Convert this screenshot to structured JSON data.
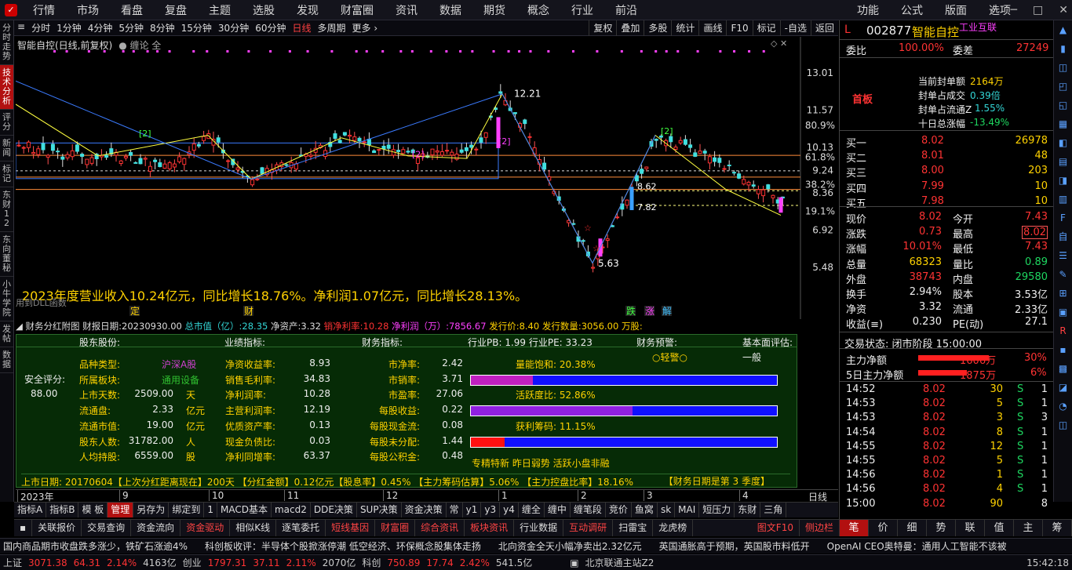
{
  "menu": [
    "行情",
    "市场",
    "看盘",
    "复盘",
    "主题",
    "选股",
    "发现",
    "财富圈",
    "资讯",
    "数据",
    "期货",
    "概念",
    "行业",
    "前沿"
  ],
  "menu_right": [
    "功能",
    "公式",
    "版面",
    "选项"
  ],
  "left_rail": [
    "分时走势",
    "技术分析",
    "评分",
    "新闻",
    "标记",
    "东财12",
    "东向董秘",
    "小牛学院",
    "发帖",
    "数据"
  ],
  "toolbar": {
    "periods": [
      "分时",
      "1分钟",
      "4分钟",
      "5分钟",
      "8分钟",
      "15分钟",
      "30分钟",
      "60分钟",
      "日线",
      "多周期",
      "更多 ›"
    ],
    "active": "日线",
    "right": [
      "复权",
      "叠加",
      "多股",
      "统计",
      "画线",
      "F10",
      "标记",
      "-自选",
      "返回"
    ]
  },
  "chart": {
    "title": "智能自控(日线,前复权)",
    "overlay": "缠论 全",
    "price_labels": [
      "13.01",
      "11.57",
      "10.13",
      "9.24",
      "8.36",
      "6.92",
      "5.48"
    ],
    "pct_labels": [
      "80.9%",
      "61.8%",
      "38.2%",
      "19.1%"
    ],
    "annot_high": "12.21",
    "annot_low": "5.63",
    "annot_b1": "8.62",
    "annot_b2": "7.82",
    "pivot_labels": [
      "[2]",
      "[2]",
      "[2]",
      "[2]"
    ],
    "event_labels": [
      "定",
      "财",
      "跌",
      "涨",
      "解"
    ],
    "headline": "2023年度营业收入10.24亿元，同比增长18.76%。净利润1.07亿元，同比增长28.13%。",
    "sub_note": "用到DLL函数",
    "date_axis": [
      "2023年",
      "9",
      "10",
      "11",
      "12",
      "1",
      "2",
      "3",
      "4"
    ],
    "period_label": "日线"
  },
  "fin_header": {
    "title": "财务分红附图",
    "report_date_label": "财报日期:",
    "report_date": "20230930.00",
    "mkt_cap_label": "总市值（亿）:",
    "mkt_cap": "28.35",
    "net_asset_label": "净资产:",
    "net_asset": "3.32",
    "sales_margin_label": "销净利率:",
    "sales_margin": "10.28",
    "net_profit_label": "净利润（万）:",
    "net_profit": "7856.67",
    "issue_price_label": "发行价:",
    "issue_price": "8.40",
    "issue_qty_label": "发行数量:",
    "issue_qty": "3056.00",
    "wan_label": "万股:"
  },
  "fin_panel": {
    "cols": [
      "股东股份:",
      "业绩指标:",
      "财务指标:",
      "行业PB:  1.99    行业PE:  33.23",
      "财务预警:",
      "基本面评估:"
    ],
    "warn": "○轻警○",
    "eval": "一般",
    "safety_label": "安全评分:",
    "safety": "88.00",
    "rows": [
      [
        "品种类型:",
        "沪深A股",
        "",
        "净资收益率:",
        "8.93",
        "市净率:",
        "2.42"
      ],
      [
        "所属板块:",
        "通用设备",
        "",
        "销售毛利率:",
        "34.83",
        "市销率:",
        "3.71"
      ],
      [
        "上市天数:",
        "2509.00",
        "天",
        "净利润率:",
        "10.28",
        "市盈率:",
        "27.06"
      ],
      [
        "流通盘:",
        "2.33",
        "亿元",
        "主营利润率:",
        "12.19",
        "每股收益:",
        "0.22"
      ],
      [
        "流通市值:",
        "19.00",
        "亿元",
        "优质资产率:",
        "0.13",
        "每股现金流:",
        "0.08"
      ],
      [
        "股东人数:",
        "31782.00",
        "人",
        "现金负债比:",
        "0.03",
        "每股未分配:",
        "1.44"
      ],
      [
        "人均持股:",
        "6559.00",
        "股",
        "净利同增率:",
        "63.37",
        "每股公积金:",
        "0.48"
      ]
    ],
    "bars": [
      {
        "label": "量能饱和:  20.38%",
        "value": 20.38,
        "color": "#c020c0"
      },
      {
        "label": "活跃度比:  52.86%",
        "value": 52.86,
        "color": "#9020e0"
      },
      {
        "label": "获利筹码:  11.15%",
        "value": 11.15,
        "color": "#ff1010"
      }
    ],
    "tags": "专精特新  昨日弱势  活跃小盘非融",
    "footer": "上市日期: 20170604【上次分红距离现在】200天  【分红金额】0.12亿元【股息率】0.45%  【主力筹码估算】5.06%  【主力控盘比率】18.16%",
    "footer_right": "【财务日期是第   3   季度】"
  },
  "tabs1": [
    "指标A",
    "指标B",
    "模 板",
    "管理",
    "另存为",
    "绑定到",
    "1",
    "MACD基本",
    "macd2",
    "DDE决策",
    "SUP决策",
    "资金决策",
    "常",
    "y1",
    "y3",
    "y4",
    "缠全",
    "缠中",
    "缠笔段",
    "竞价",
    "鱼窝",
    "sk",
    "MAI",
    "短压力",
    "东财",
    "三角"
  ],
  "tabs1_active": "管理",
  "tabs2": [
    "关联报价",
    "交易查询",
    "资金流向",
    "资金驱动",
    "相似K线",
    "逐笔委托",
    "短线基因",
    "财富圈",
    "综合资讯",
    "板块资讯",
    "行业数据",
    "互动调研",
    "扫雷宝",
    "龙虎榜"
  ],
  "tabs2_red": [
    "资金驱动",
    "短线基因",
    "财富圈",
    "综合资讯",
    "板块资讯",
    "互动调研"
  ],
  "tabs2_right": [
    "图文F10",
    "侧边栏"
  ],
  "quote": {
    "flag": "L",
    "code": "002877",
    "name": "智能自控",
    "industry": "工业互联",
    "wb_label": "委比",
    "wb": "100.00%",
    "wc_label": "委差",
    "wc": "27249",
    "board": "首板",
    "seal_label": "当前封单额",
    "seal": "2164万",
    "seal_vol_label": "封单占成交",
    "seal_vol": "0.39倍",
    "seal_float_label": "封单占流通Z",
    "seal_float": "1.55%",
    "ten_day_label": "十日总涨幅",
    "ten_day": "-13.49%",
    "bids": [
      [
        "买一",
        "8.02",
        "26978"
      ],
      [
        "买二",
        "8.01",
        "48"
      ],
      [
        "买三",
        "8.00",
        "203"
      ],
      [
        "买四",
        "7.99",
        "10"
      ],
      [
        "买五",
        "7.98",
        "10"
      ]
    ],
    "stats": [
      [
        "现价",
        "8.02",
        "今开",
        "7.43"
      ],
      [
        "涨跌",
        "0.73",
        "最高",
        "8.02"
      ],
      [
        "涨幅",
        "10.01%",
        "最低",
        "7.43"
      ],
      [
        "总量",
        "68323",
        "量比",
        "0.89"
      ],
      [
        "外盘",
        "38743",
        "内盘",
        "29580"
      ],
      [
        "换手",
        "2.94%",
        "股本",
        "3.53亿"
      ],
      [
        "净资",
        "3.32",
        "流通",
        "2.33亿"
      ],
      [
        "收益(≡)",
        "0.230",
        "PE(动)",
        "27.1"
      ]
    ],
    "trade_state": "交易状态: 闭市阶段 15:00:00",
    "main_net_label": "主力净额",
    "main_net": "1606万",
    "main_net_pct": "30%",
    "five_net_label": "5日主力净额",
    "five_net": "1875万",
    "five_net_pct": "6%",
    "ticks": [
      [
        "14:52",
        "8.02",
        "30",
        "S",
        "1"
      ],
      [
        "14:53",
        "8.02",
        "5",
        "S",
        "1"
      ],
      [
        "14:53",
        "8.02",
        "3",
        "S",
        "3"
      ],
      [
        "14:54",
        "8.02",
        "8",
        "S",
        "1"
      ],
      [
        "14:55",
        "8.02",
        "12",
        "S",
        "1"
      ],
      [
        "14:55",
        "8.02",
        "5",
        "S",
        "1"
      ],
      [
        "14:56",
        "8.02",
        "1",
        "S",
        "1"
      ],
      [
        "14:56",
        "8.02",
        "4",
        "S",
        "1"
      ],
      [
        "15:00",
        "8.02",
        "90",
        "",
        "8"
      ]
    ]
  },
  "rtabs": [
    "笔",
    "价",
    "细",
    "势",
    "联",
    "值",
    "主",
    "筹"
  ],
  "ticker": [
    "国内商品期市收盘跌多涨少，铁矿石涨逾4%",
    "科创板收评：半导体个股掀涨停潮 低空经济、环保概念股集体走扬",
    "北向资金全天小幅净卖出2.32亿元",
    "英国通胀高于预期，英国股市料低开",
    "OpenAI CEO奥特曼：通用人工智能不该被"
  ],
  "status": {
    "sh_label": "上证",
    "sh": "3071.38",
    "sh_chg": "64.31",
    "sh_pct": "2.14%",
    "sh_amt": "4163亿",
    "cy_label": "创业",
    "cy": "1797.31",
    "cy_chg": "37.11",
    "cy_pct": "2.11%",
    "cy_amt": "2070亿",
    "kc_label": "科创",
    "kc": "750.89",
    "kc_chg": "17.74",
    "kc_pct": "2.42%",
    "kc_amt": "541.5亿",
    "server": "北京联通主站Z2",
    "time": "15:42:18"
  }
}
